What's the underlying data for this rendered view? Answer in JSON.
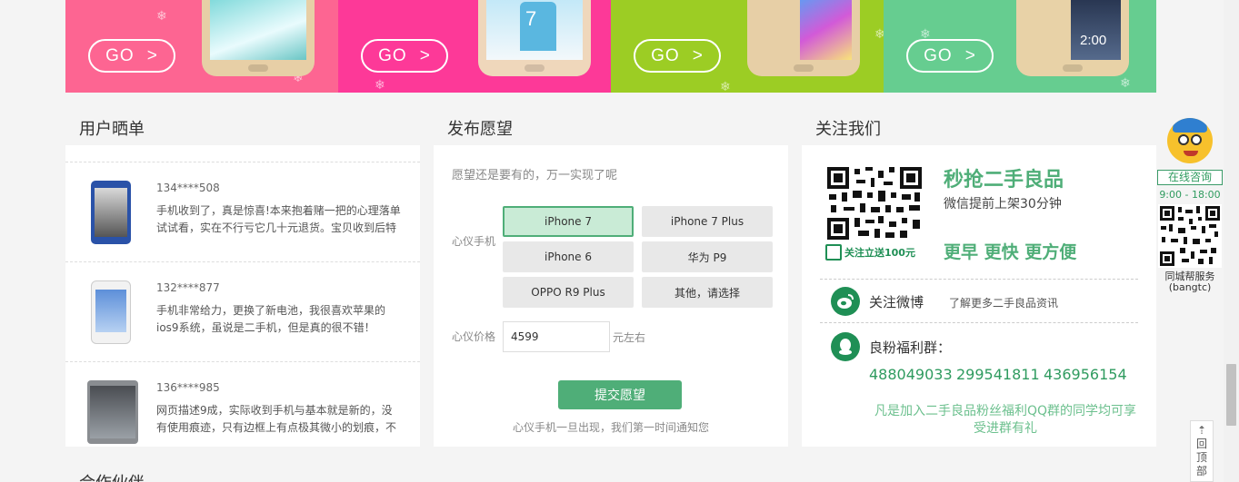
{
  "banner": {
    "go_label": "GO",
    "go_arrow": ">",
    "panels": [
      {
        "color": "#fd6592"
      },
      {
        "color": "#fd3998"
      },
      {
        "color": "#9ccd24"
      },
      {
        "color": "#66cd90"
      }
    ],
    "logo_text": "7",
    "badge_text": "2:00"
  },
  "reviews": {
    "title": "用户晒单",
    "items": [
      {
        "user": "134****508",
        "text": "手机收到了，真是惊喜!本来抱着赌一把的心理落单试试看，实在不行亏它几十元退货。宝贝收到后特"
      },
      {
        "user": "132****877",
        "text": "手机非常给力，更换了新电池，我很喜欢苹果的ios9系统，虽说是二手机，但是真的很不错！"
      },
      {
        "user": "136****985",
        "text": "网页描述9成，实际收到手机与基本就是新的，没有使用痕迹，只有边框上有点极其微小的划痕，不"
      }
    ]
  },
  "wish": {
    "title": "发布愿望",
    "hint": "愿望还是要有的，万一实现了呢",
    "phone_label": "心仪手机",
    "options": [
      "iPhone 7",
      "iPhone 7 Plus",
      "iPhone 6",
      "华为 P9",
      "OPPO R9 Plus",
      "其他，请选择"
    ],
    "selected": "iPhone 7",
    "price_label": "心仪价格",
    "price_value": "4599",
    "price_unit": "元左右",
    "submit_label": "提交愿望",
    "note": "心仪手机一旦出现，我们第一时间通知您"
  },
  "follow": {
    "title": "关注我们",
    "headline": "秒抢二手良品",
    "subline": "微信提前上架30分钟",
    "qr_caption": "关注立送100元",
    "slogan": "更早 更快 更方便",
    "weibo_label": "关注微博",
    "weibo_desc": "了解更多二手良品资讯",
    "qq_label": "良粉福利群：",
    "qq_groups": [
      "488049033",
      "299541811",
      "436956154"
    ],
    "qq_note": "凡是加入二手良品粉丝福利QQ群的同学均可享受进群有礼"
  },
  "side": {
    "consult_label": "在线咨询",
    "hours": "9:00 - 18:00",
    "service_name": "同城帮服务",
    "service_id": "(bangtc)",
    "back_top": "回顶部"
  },
  "partners": {
    "title": "合作伙伴"
  },
  "colors": {
    "accent": "#4fae78",
    "qq_number": "#2f9b5f"
  }
}
